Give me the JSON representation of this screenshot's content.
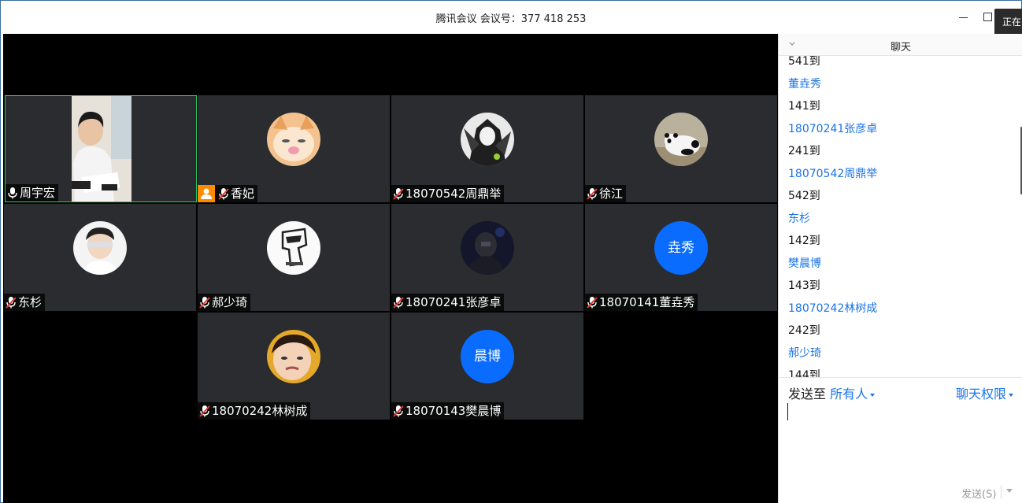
{
  "window": {
    "title": "腾讯会议 会议号：377 418 253",
    "speaking_tip": "正在"
  },
  "participants": [
    {
      "name": "周宇宏",
      "mic": "on",
      "avatar": "video"
    },
    {
      "name": "香妃",
      "mic": "muted",
      "avatar": "photo-kitten",
      "host": true
    },
    {
      "name": "18070542周鼎举",
      "mic": "muted",
      "avatar": "photo-character"
    },
    {
      "name": "徐江",
      "mic": "muted",
      "avatar": "photo-panda"
    },
    {
      "name": "东杉",
      "mic": "muted",
      "avatar": "photo-person"
    },
    {
      "name": "郝少琦",
      "mic": "muted",
      "avatar": "photo-logo"
    },
    {
      "name": "18070241张彦卓",
      "mic": "muted",
      "avatar": "photo-dark"
    },
    {
      "name": "18070141董垚秀",
      "mic": "muted",
      "avatar_text": "垚秀",
      "avatar_color": "#0a6cff"
    },
    {
      "name": "18070242林树成",
      "mic": "muted",
      "avatar": "photo-face"
    },
    {
      "name": "18070143樊晨博",
      "mic": "muted",
      "avatar_text": "晨博",
      "avatar_color": "#0a6cff"
    }
  ],
  "chat": {
    "title": "聊天",
    "messages": [
      {
        "kind": "text",
        "value": "541到"
      },
      {
        "kind": "sender",
        "value": "董垚秀"
      },
      {
        "kind": "text",
        "value": "141到"
      },
      {
        "kind": "sender",
        "value": "18070241张彦卓"
      },
      {
        "kind": "text",
        "value": "241到"
      },
      {
        "kind": "sender",
        "value": "18070542周鼎举"
      },
      {
        "kind": "text",
        "value": "542到"
      },
      {
        "kind": "sender",
        "value": "东杉"
      },
      {
        "kind": "text",
        "value": "142到"
      },
      {
        "kind": "sender",
        "value": "樊晨博"
      },
      {
        "kind": "text",
        "value": "143到"
      },
      {
        "kind": "sender",
        "value": "18070242林树成"
      },
      {
        "kind": "text",
        "value": "242到"
      },
      {
        "kind": "sender",
        "value": "郝少琦"
      },
      {
        "kind": "text",
        "value": "144到"
      }
    ],
    "send_to_label": "发送至",
    "send_to_target": "所有人",
    "permission_label": "聊天权限",
    "send_button": "发送(S)"
  },
  "colors": {
    "accent": "#1a73e8",
    "tile_bg": "#2a2c2f",
    "host_badge": "#ff8a00",
    "active_border": "#2ecc71",
    "text_avatar": "#0a6cff"
  }
}
